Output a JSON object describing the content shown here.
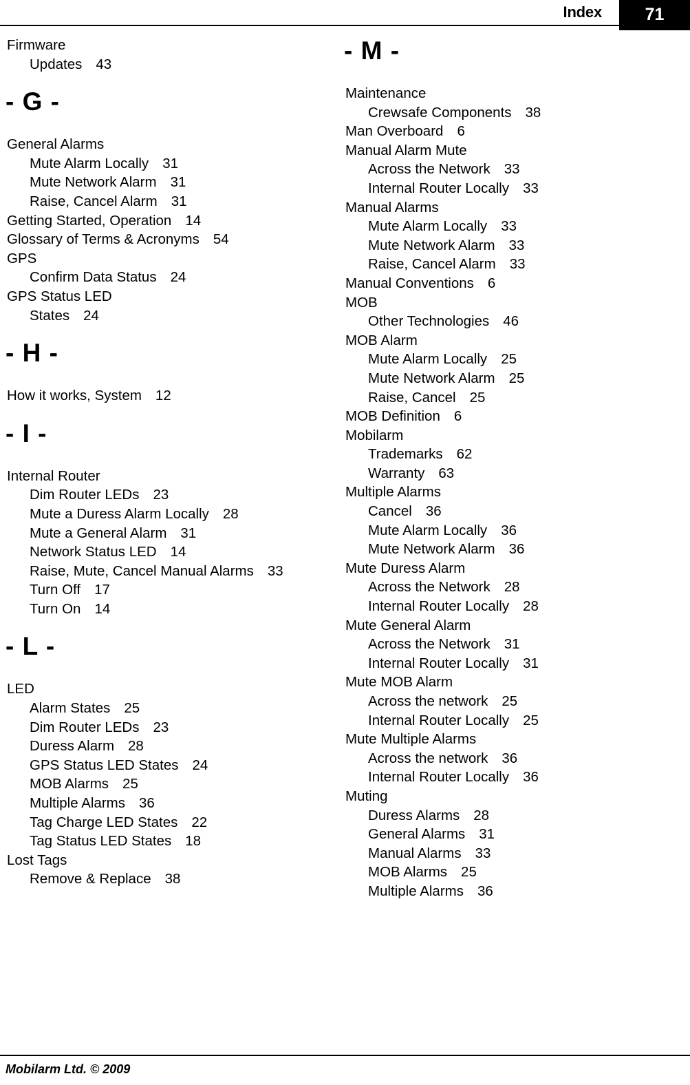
{
  "header": {
    "title": "Index",
    "page_number": "71"
  },
  "footer": {
    "copyright": "Mobilarm Ltd. © 2009"
  },
  "columns": [
    {
      "name": "left",
      "blocks": [
        {
          "type": "group",
          "entries": [
            {
              "level": 1,
              "label": "Firmware",
              "page": ""
            },
            {
              "level": 2,
              "label": "Updates",
              "page": "43"
            }
          ]
        },
        {
          "type": "letter",
          "label": "- G -",
          "first": false
        },
        {
          "type": "group",
          "entries": [
            {
              "level": 1,
              "label": "General Alarms",
              "page": ""
            },
            {
              "level": 2,
              "label": "Mute Alarm Locally",
              "page": "31"
            },
            {
              "level": 2,
              "label": "Mute Network Alarm",
              "page": "31"
            },
            {
              "level": 2,
              "label": "Raise, Cancel Alarm",
              "page": "31"
            }
          ]
        },
        {
          "type": "group",
          "entries": [
            {
              "level": 1,
              "label": "Getting Started, Operation",
              "page": "14"
            }
          ]
        },
        {
          "type": "group",
          "entries": [
            {
              "level": 1,
              "label": "Glossary of Terms & Acronyms",
              "page": "54"
            }
          ]
        },
        {
          "type": "group",
          "entries": [
            {
              "level": 1,
              "label": "GPS",
              "page": ""
            },
            {
              "level": 2,
              "label": "Confirm Data Status",
              "page": "24"
            }
          ]
        },
        {
          "type": "group",
          "entries": [
            {
              "level": 1,
              "label": "GPS Status LED",
              "page": ""
            },
            {
              "level": 2,
              "label": "States",
              "page": "24"
            }
          ]
        },
        {
          "type": "letter",
          "label": "- H -",
          "first": false
        },
        {
          "type": "group",
          "entries": [
            {
              "level": 1,
              "label": "How it works, System",
              "page": "12"
            }
          ]
        },
        {
          "type": "letter",
          "label": "- I -",
          "first": false
        },
        {
          "type": "group",
          "entries": [
            {
              "level": 1,
              "label": "Internal Router",
              "page": ""
            },
            {
              "level": 2,
              "label": "Dim Router LEDs",
              "page": "23"
            },
            {
              "level": 2,
              "label": "Mute a Duress Alarm Locally",
              "page": "28"
            },
            {
              "level": 2,
              "label": "Mute a General Alarm",
              "page": "31"
            },
            {
              "level": 2,
              "label": "Network Status LED",
              "page": "14"
            },
            {
              "level": 2,
              "label": "Raise, Mute, Cancel Manual Alarms",
              "page": "33"
            },
            {
              "level": 2,
              "label": "Turn Off",
              "page": "17"
            },
            {
              "level": 2,
              "label": "Turn On",
              "page": "14"
            }
          ]
        },
        {
          "type": "letter",
          "label": "- L -",
          "first": false
        },
        {
          "type": "group",
          "entries": [
            {
              "level": 1,
              "label": "LED",
              "page": ""
            },
            {
              "level": 2,
              "label": "Alarm States",
              "page": "25"
            },
            {
              "level": 2,
              "label": "Dim Router LEDs",
              "page": "23"
            },
            {
              "level": 2,
              "label": "Duress Alarm",
              "page": "28"
            },
            {
              "level": 2,
              "label": "GPS Status LED States",
              "page": "24"
            },
            {
              "level": 2,
              "label": "MOB Alarms",
              "page": "25"
            },
            {
              "level": 2,
              "label": "Multiple Alarms",
              "page": "36"
            },
            {
              "level": 2,
              "label": "Tag Charge LED States",
              "page": "22"
            },
            {
              "level": 2,
              "label": "Tag Status LED States",
              "page": "18"
            }
          ]
        },
        {
          "type": "group",
          "entries": [
            {
              "level": 1,
              "label": "Lost Tags",
              "page": ""
            },
            {
              "level": 2,
              "label": "Remove & Replace",
              "page": "38"
            }
          ]
        }
      ]
    },
    {
      "name": "right",
      "blocks": [
        {
          "type": "letter",
          "label": "- M -",
          "first": true
        },
        {
          "type": "group",
          "entries": [
            {
              "level": 1,
              "label": "Maintenance",
              "page": ""
            },
            {
              "level": 2,
              "label": "Crewsafe Components",
              "page": "38"
            }
          ]
        },
        {
          "type": "group",
          "entries": [
            {
              "level": 1,
              "label": "Man Overboard",
              "page": "6"
            }
          ]
        },
        {
          "type": "group",
          "entries": [
            {
              "level": 1,
              "label": "Manual Alarm Mute",
              "page": ""
            },
            {
              "level": 2,
              "label": "Across the Network",
              "page": "33"
            },
            {
              "level": 2,
              "label": "Internal Router Locally",
              "page": "33"
            }
          ]
        },
        {
          "type": "group",
          "entries": [
            {
              "level": 1,
              "label": "Manual Alarms",
              "page": ""
            },
            {
              "level": 2,
              "label": "Mute Alarm Locally",
              "page": "33"
            },
            {
              "level": 2,
              "label": "Mute Network Alarm",
              "page": "33"
            },
            {
              "level": 2,
              "label": "Raise, Cancel Alarm",
              "page": "33"
            }
          ]
        },
        {
          "type": "group",
          "entries": [
            {
              "level": 1,
              "label": "Manual Conventions",
              "page": "6"
            }
          ]
        },
        {
          "type": "group",
          "entries": [
            {
              "level": 1,
              "label": "MOB",
              "page": ""
            },
            {
              "level": 2,
              "label": "Other Technologies",
              "page": "46"
            }
          ]
        },
        {
          "type": "group",
          "entries": [
            {
              "level": 1,
              "label": "MOB Alarm",
              "page": ""
            },
            {
              "level": 2,
              "label": "Mute Alarm Locally",
              "page": "25"
            },
            {
              "level": 2,
              "label": "Mute Network Alarm",
              "page": "25"
            },
            {
              "level": 2,
              "label": "Raise, Cancel",
              "page": "25"
            }
          ]
        },
        {
          "type": "group",
          "entries": [
            {
              "level": 1,
              "label": "MOB Definition",
              "page": "6"
            }
          ]
        },
        {
          "type": "group",
          "entries": [
            {
              "level": 1,
              "label": "Mobilarm",
              "page": ""
            },
            {
              "level": 2,
              "label": "Trademarks",
              "page": "62"
            },
            {
              "level": 2,
              "label": "Warranty",
              "page": "63"
            }
          ]
        },
        {
          "type": "group",
          "entries": [
            {
              "level": 1,
              "label": "Multiple Alarms",
              "page": ""
            },
            {
              "level": 2,
              "label": "Cancel",
              "page": "36"
            },
            {
              "level": 2,
              "label": "Mute Alarm Locally",
              "page": "36"
            },
            {
              "level": 2,
              "label": "Mute Network Alarm",
              "page": "36"
            }
          ]
        },
        {
          "type": "group",
          "entries": [
            {
              "level": 1,
              "label": "Mute Duress Alarm",
              "page": ""
            },
            {
              "level": 2,
              "label": "Across the Network",
              "page": "28"
            },
            {
              "level": 2,
              "label": "Internal Router Locally",
              "page": "28"
            }
          ]
        },
        {
          "type": "group",
          "entries": [
            {
              "level": 1,
              "label": "Mute General Alarm",
              "page": ""
            },
            {
              "level": 2,
              "label": "Across the Network",
              "page": "31"
            },
            {
              "level": 2,
              "label": "Internal Router Locally",
              "page": "31"
            }
          ]
        },
        {
          "type": "group",
          "entries": [
            {
              "level": 1,
              "label": "Mute MOB Alarm",
              "page": ""
            },
            {
              "level": 2,
              "label": "Across the network",
              "page": "25"
            },
            {
              "level": 2,
              "label": "Internal Router Locally",
              "page": "25"
            }
          ]
        },
        {
          "type": "group",
          "entries": [
            {
              "level": 1,
              "label": "Mute Multiple Alarms",
              "page": ""
            },
            {
              "level": 2,
              "label": "Across the network",
              "page": "36"
            },
            {
              "level": 2,
              "label": "Internal Router Locally",
              "page": "36"
            }
          ]
        },
        {
          "type": "group",
          "entries": [
            {
              "level": 1,
              "label": "Muting",
              "page": ""
            },
            {
              "level": 2,
              "label": "Duress Alarms",
              "page": "28"
            },
            {
              "level": 2,
              "label": "General Alarms",
              "page": "31"
            },
            {
              "level": 2,
              "label": "Manual Alarms",
              "page": "33"
            },
            {
              "level": 2,
              "label": "MOB Alarms",
              "page": "25"
            },
            {
              "level": 2,
              "label": "Multiple Alarms",
              "page": "36"
            }
          ]
        }
      ]
    }
  ]
}
